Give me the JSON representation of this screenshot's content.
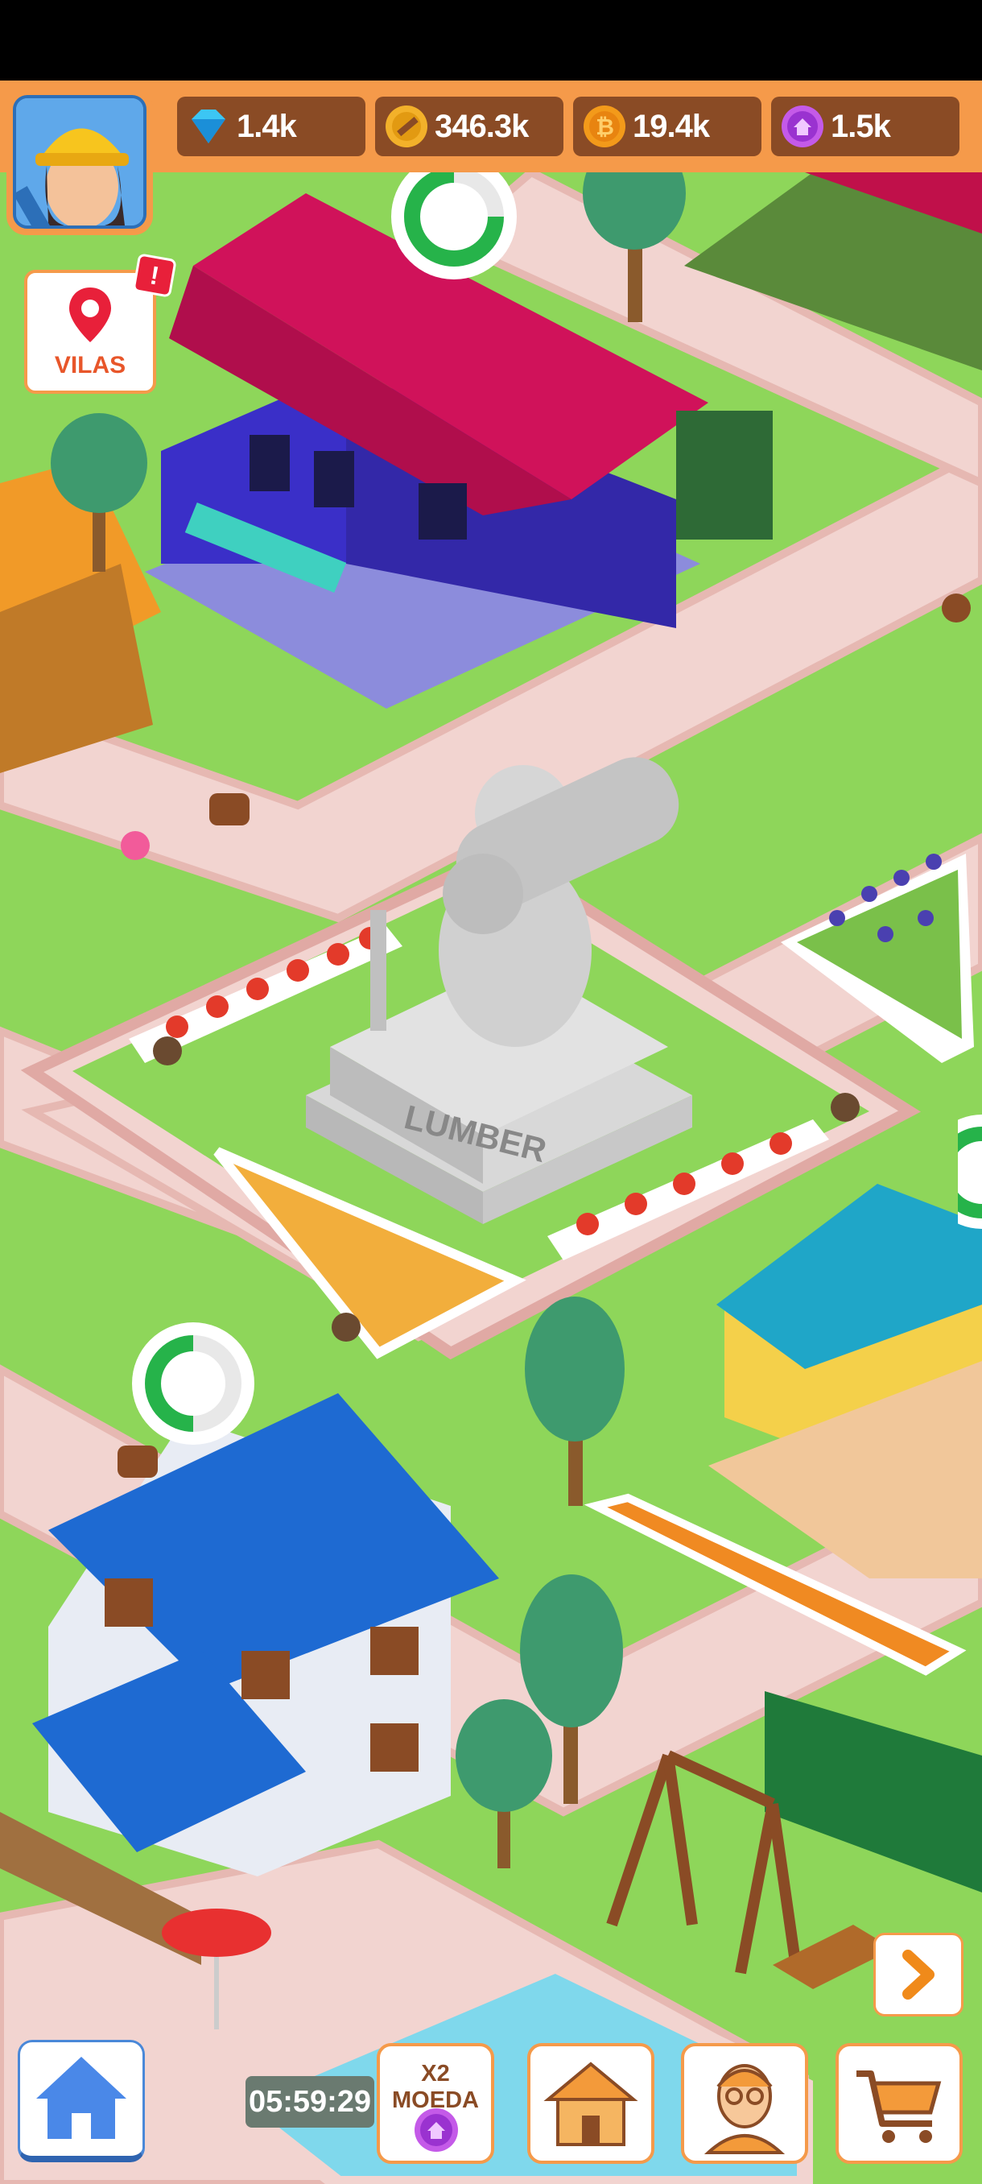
{
  "resources": {
    "gems": "1.4k",
    "hammers": "346.3k",
    "coins": "19.4k",
    "tokens": "1.5k"
  },
  "vilas_button": {
    "label": "VILAS",
    "alert": "!"
  },
  "statue_plaque": "LUMBER",
  "bottom_bar": {
    "timer": "05:59:29",
    "x2_label": "X2 MOEDA"
  },
  "icons": {
    "gems": "diamond-icon",
    "hammers": "hammer-coin-icon",
    "coins": "bitcoin-coin-icon",
    "tokens": "purple-house-token-icon",
    "vilas": "map-pin-icon",
    "home": "home-icon",
    "shop": "log-cabin-icon",
    "manager": "manager-portrait-icon",
    "cart": "shopping-cart-icon",
    "next": "chevron-right-icon"
  },
  "colors": {
    "accent": "#f59a4a",
    "resource_bg": "#8a4b25",
    "grass": "#8ed65a",
    "path": "#f3d6d3"
  }
}
